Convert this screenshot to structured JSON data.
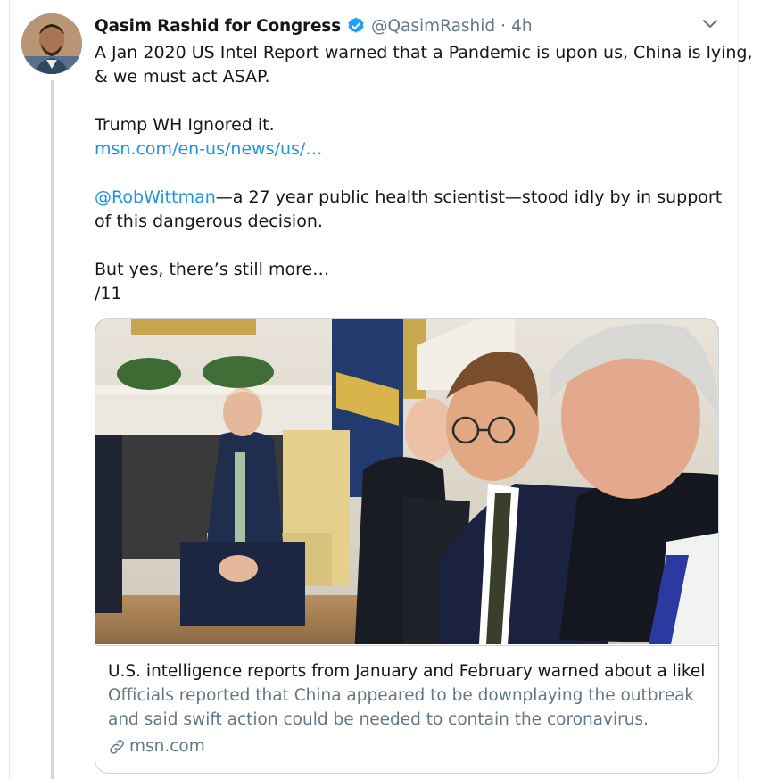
{
  "tweet": {
    "author_name": "Qasim Rashid for Congress",
    "handle": "@QasimRashid",
    "separator": "·",
    "time": "4h",
    "lines": [
      {
        "text": "A Jan 2020 US Intel Report warned that a Pandemic is upon us, China is lying,"
      },
      {
        "text": "& we must act ASAP."
      },
      {
        "text": "Trump WH Ignored it."
      },
      {
        "link": "msn.com/en-us/news/us/…"
      },
      {
        "mention": "@RobWittman",
        "text": "—a 27 year public health scientist—stood idly by in support"
      },
      {
        "text": "of this dangerous decision."
      },
      {
        "text": "But yes, there’s still more…"
      },
      {
        "text": "/11"
      }
    ]
  },
  "card": {
    "title": "U.S. intelligence reports from January and February warned about a likel…",
    "description_lines": [
      "Officials reported that China appeared to be downplaying the outbreak",
      "and said swift action could be needed to contain the coronavirus."
    ],
    "domain": "msn.com"
  },
  "colors": {
    "link": "#1b95e0",
    "verified_badge": "#1da1f2",
    "secondary_text": "#657786",
    "border": "#ccd6dd"
  },
  "icons": {
    "verified": "verified-badge-icon",
    "caret": "chevron-down-icon",
    "link": "link-icon"
  }
}
